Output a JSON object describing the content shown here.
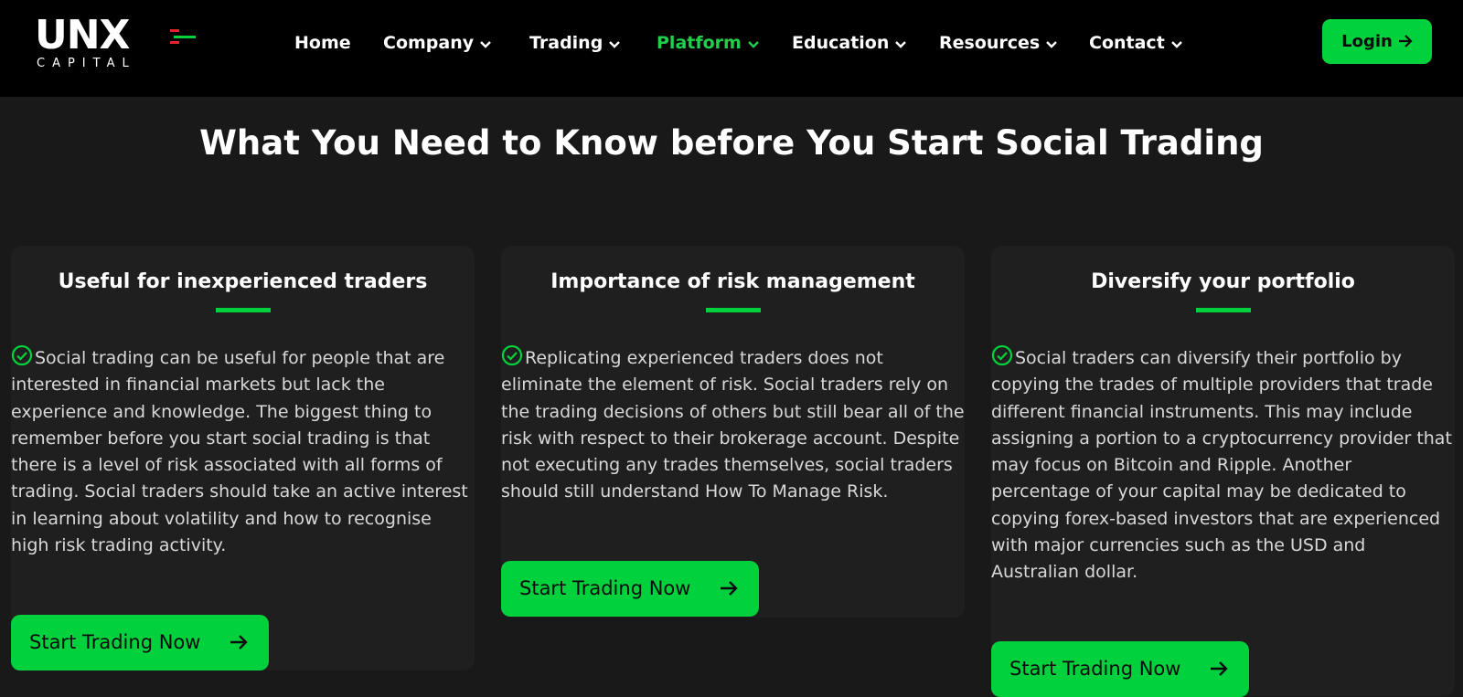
{
  "header": {
    "logo": {
      "main": "UNX",
      "sub": "CAPITAL"
    },
    "nav": [
      {
        "label": "Home",
        "has_dropdown": false,
        "active": false
      },
      {
        "label": "Company",
        "has_dropdown": true,
        "active": false
      },
      {
        "label": "Trading",
        "has_dropdown": true,
        "active": false
      },
      {
        "label": "Platform",
        "has_dropdown": true,
        "active": true
      },
      {
        "label": "Education",
        "has_dropdown": true,
        "active": false
      },
      {
        "label": "Resources",
        "has_dropdown": true,
        "active": false
      },
      {
        "label": "Contact",
        "has_dropdown": true,
        "active": false
      }
    ],
    "login_label": "Login"
  },
  "main": {
    "title": "What You Need to Know before You Start Social Trading",
    "cards": [
      {
        "title": "Useful for inexperienced traders",
        "body": "Social trading can be useful for people that are interested in financial markets but lack the experience and knowledge. The biggest thing to remember before you start social trading is that there is a level of risk associated with all forms of trading. Social traders should take an active interest in learning about volatility and how to recognise high risk trading activity.",
        "cta": "Start Trading Now"
      },
      {
        "title": "Importance of risk management",
        "body": "Replicating experienced traders does not eliminate the element of risk. Social traders rely on the trading decisions of others but still bear all of the risk with respect to their brokerage account. Despite not executing any trades themselves, social traders should still understand How To Manage Risk.",
        "cta": "Start Trading Now"
      },
      {
        "title": "Diversify your portfolio",
        "body": "Social traders can diversify their portfolio by copying the trades of multiple providers that trade different financial instruments. This may include assigning a portion to a cryptocurrency provider that may focus on Bitcoin and Ripple. Another percentage of your capital may be dedicated to copying forex-based investors that are experienced with major currencies such as the USD and Australian dollar.",
        "cta": "Start Trading Now"
      }
    ]
  },
  "colors": {
    "accent": "#00d13d",
    "header_bg": "#000000",
    "page_bg": "#191919",
    "card_bg": "#1f1f1f",
    "body_text": "#d8d8d8",
    "logo_red": "#e0262b"
  },
  "icons": [
    "chevron-down-icon",
    "arrow-right-icon",
    "check-circle-icon"
  ]
}
